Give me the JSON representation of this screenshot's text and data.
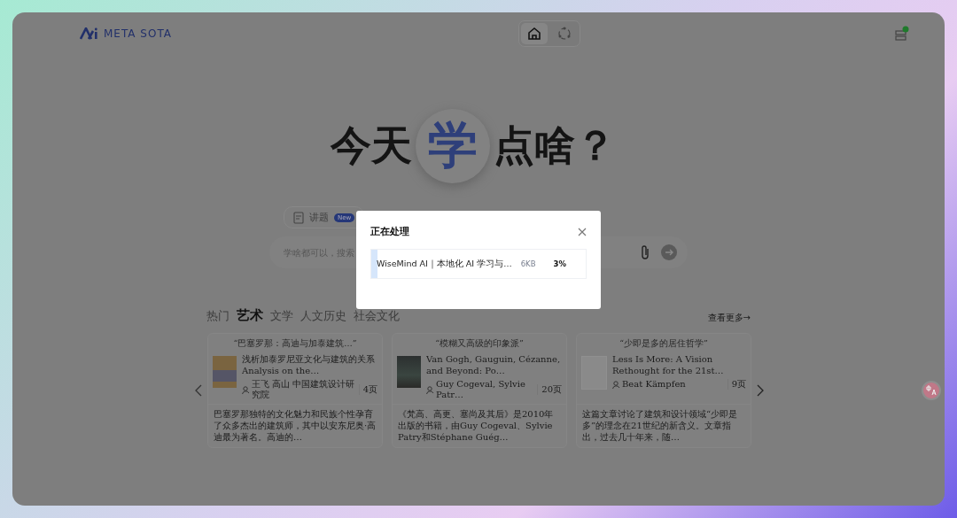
{
  "header": {
    "logo": "META SOTA",
    "nav": [
      {
        "kind": "home",
        "selected": true
      },
      {
        "kind": "orbit",
        "selected": false
      }
    ]
  },
  "hero": {
    "before": "今天",
    "highlight": "学",
    "after": "点啥？"
  },
  "tool": {
    "label": "讲题",
    "badge": "New"
  },
  "search": {
    "placeholder": "学啥都可以，搜索"
  },
  "categories": [
    {
      "label": "热门",
      "selected": false
    },
    {
      "label": "艺术",
      "selected": true
    },
    {
      "label": "文学",
      "selected": false
    },
    {
      "label": "人文历史",
      "selected": false
    },
    {
      "label": "社会文化",
      "selected": false
    }
  ],
  "more": "查看更多→",
  "cards": [
    {
      "quote": "“巴塞罗那：高迪与加泰建筑…”",
      "kind": "scan",
      "title": "浅析加泰罗尼亚文化与建筑的关系 Analysis on the…",
      "author": "王飞 高山 中国建筑设计研究院",
      "pages": "4页",
      "summary": "巴塞罗那独特的文化魅力和民族个性孕育了众多杰出的建筑师，其中以安东尼奥·高迪最为著名。高迪的…"
    },
    {
      "quote": "“模糊又高级的印象派”",
      "kind": "painting",
      "title": "Van Gogh, Gauguin, Cézanne, and Beyond: Po…",
      "author": "Guy Cogeval, Sylvie Patr…",
      "pages": "20页",
      "summary": "《梵高、高更、塞尚及其后》是2010年出版的书籍，由Guy Cogeval、Sylvie Patry和Stéphane Guég…"
    },
    {
      "quote": "“少即是多的居住哲学”",
      "kind": "document",
      "title": "Less Is More: A Vision Rethought for the 21st…",
      "author": "Beat Kämpfen",
      "pages": "9页",
      "summary": "这篇文章讨论了建筑和设计领域“少即是多”的理念在21世纪的新含义。文章指出，过去几十年来，随…"
    }
  ],
  "dialog": {
    "title": "正在处理",
    "files": [
      {
        "name": "WiseMind AI｜本地化 AI 学习与…",
        "size": "6KB",
        "progress": "3%",
        "level": 0.03
      }
    ]
  }
}
